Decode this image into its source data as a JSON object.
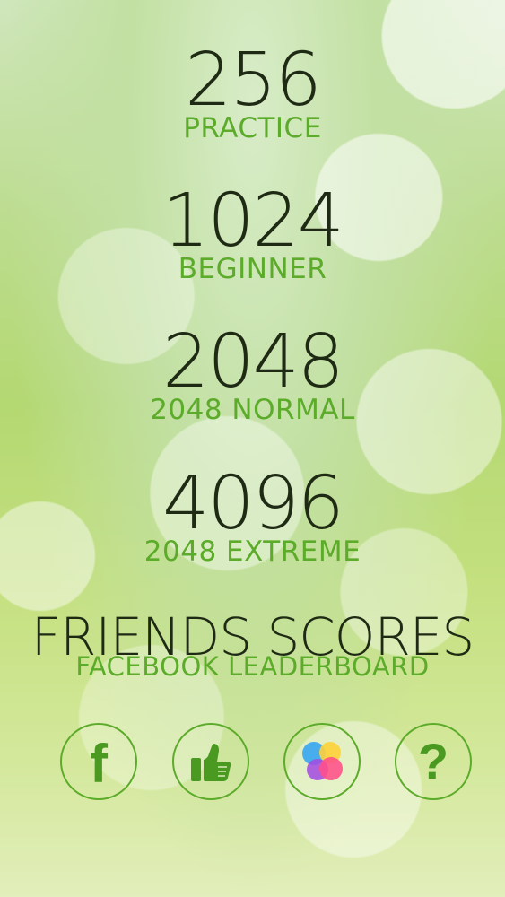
{
  "modes": [
    {
      "score": "256",
      "label": "PRACTICE"
    },
    {
      "score": "1024",
      "label": "BEGINNER"
    },
    {
      "score": "2048",
      "label": "2048 NORMAL"
    },
    {
      "score": "4096",
      "label": "2048 EXTREME"
    }
  ],
  "friends": {
    "title": "FRIENDS SCORES",
    "subtitle": "FACEBOOK LEADERBOARD"
  },
  "icons": {
    "facebook": "facebook-icon",
    "like": "thumbs-up-icon",
    "game_center": "game-center-icon",
    "help": "help-icon",
    "facebook_glyph": "f",
    "help_glyph": "?"
  },
  "colors": {
    "accent": "#5cab2a",
    "score_text": "#1f2a14"
  }
}
